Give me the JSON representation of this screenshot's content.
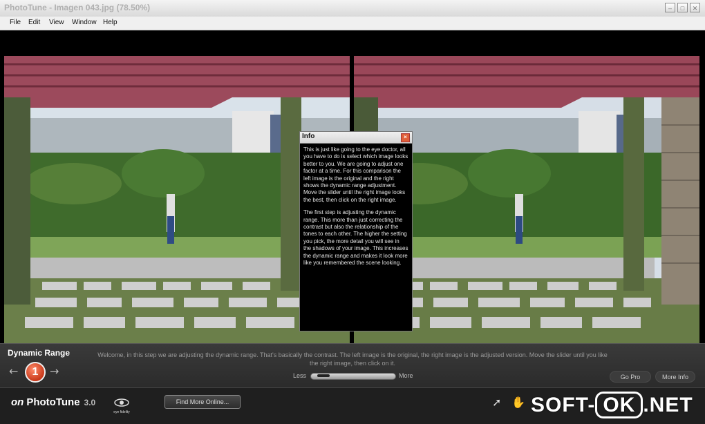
{
  "window": {
    "title": "PhotoTune - Imagen 043.jpg (78.50%)",
    "minimize_icon": "minimize-icon",
    "maximize_icon": "maximize-icon",
    "close_icon": "close-icon"
  },
  "menu": [
    "File",
    "Edit",
    "View",
    "Window",
    "Help"
  ],
  "info_dialog": {
    "title": "Info",
    "paragraph1": "This is just like going to the eye doctor, all you have to do is select which image looks better to you. We are going to adjust one factor at a time. For this comparison the left image is the original and the right shows the dynamic range adjustment. Move the slider until the right image looks the best, then click on the right image.",
    "paragraph2": "The first step is adjusting the dynamic range. This more than just correcting the contrast but also the relationship of the tones to each other. The higher the setting you pick, the more detail you will see in the shadows of your image. This increases the dynamic range and makes it look more like you remembered the scene looking."
  },
  "step_panel": {
    "title": "Dynamic Range",
    "step_number": "1",
    "description": "Welcome, in this step we are adjusting the dynamic range. That's basically the contrast. The left image is the original, the right image is the adjusted version. Move the slider until you like the right image, then click on it.",
    "slider_less": "Less",
    "slider_more": "More",
    "slider_value_fraction": 0.05,
    "go_pro": "Go Pro",
    "more_info": "More Info"
  },
  "bottom_bar": {
    "logo_on": "on",
    "logo_name": "PhotoTune",
    "logo_version": "3.0",
    "eye_fidelity": "eye fidelity",
    "find_more": "Find More Online...",
    "watermark_left": "SOFT-",
    "watermark_ok": "OK",
    "watermark_right": ".NET"
  },
  "colors": {
    "pergola": "#9c4a5c",
    "grass": "#5f8f3c",
    "accent_step": "#d2411f"
  }
}
